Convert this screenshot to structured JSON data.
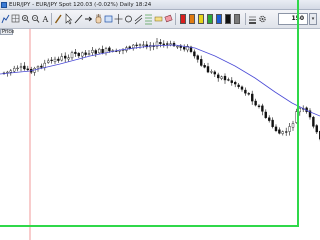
{
  "window": {
    "title": "EUR/JPY - EUR/JPY Spot   120.03 (-0.02%)   Daily  18:24"
  },
  "toolbar": {
    "buttons": [
      "chart-icon",
      "grid-icon",
      "zoom-in-icon",
      "zoom-out-icon",
      "text-icon",
      "pencil-icon",
      "cursor-icon",
      "line-icon",
      "arrow-icon",
      "hand-icon",
      "rectangle-icon",
      "crosshair-icon",
      "circle-icon",
      "channel-icon"
    ],
    "colors": [
      "#d91e1e",
      "#e07b12",
      "#e6d31a",
      "#2da83a",
      "#1a5ed6",
      "#111111",
      "#7a7a7a"
    ],
    "bars_value": "150"
  },
  "chart": {
    "axis_tag": "Price",
    "colors": {
      "candle": "#111111",
      "moving_average": "#4b4bd6",
      "vline": "#e85555",
      "highlight": "#2fd84a"
    }
  }
}
